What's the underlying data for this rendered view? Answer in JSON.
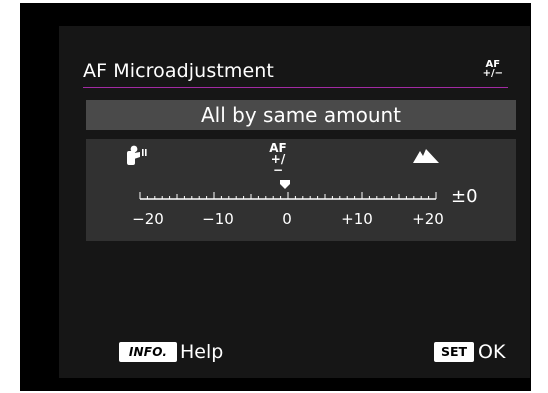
{
  "header": {
    "title": "AF Microadjustment",
    "tab_icon": {
      "name": "af-microadjust-tab-icon",
      "top": "AF",
      "bottom": "+/−"
    }
  },
  "mode": {
    "selected": "All by same amount"
  },
  "adjust": {
    "icons": {
      "near": "portrait-icon",
      "center_top": "AF",
      "center_bottom": "+/−",
      "far": "mountain-icon"
    },
    "scale": {
      "min": -20,
      "max": 20,
      "value": 0,
      "value_label": "±0",
      "tick_labels": [
        "−20",
        "−10",
        "0",
        "+10",
        "+20"
      ]
    }
  },
  "footer": {
    "info_key": "INFO.",
    "info_label": "Help",
    "set_key": "SET",
    "set_label": "OK"
  },
  "colors": {
    "background": "#000000",
    "panel": "#161616",
    "mode_bar": "#4a4a4a",
    "adjust_panel": "#313131",
    "title_underline": "#a22aa3",
    "text": "#ffffff"
  }
}
